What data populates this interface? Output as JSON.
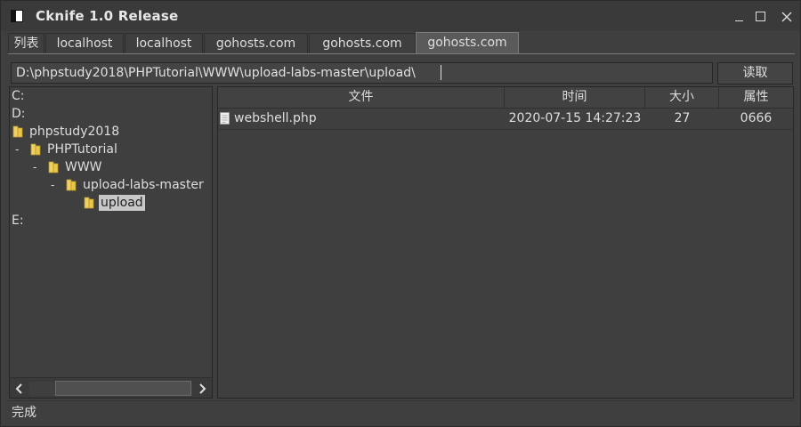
{
  "window": {
    "title": "Cknife 1.0 Release"
  },
  "tabs": [
    {
      "label": "列表"
    },
    {
      "label": "localhost"
    },
    {
      "label": "localhost"
    },
    {
      "label": "gohosts.com"
    },
    {
      "label": "gohosts.com"
    },
    {
      "label": "gohosts.com",
      "active": true
    }
  ],
  "toolbar": {
    "path_value": "D:\\phpstudy2018\\PHPTutorial\\WWW\\upload-labs-master\\upload\\",
    "read_label": "读取"
  },
  "tree": {
    "items": [
      {
        "label": "C:"
      },
      {
        "label": "D:"
      },
      {
        "label": "phpstudy2018"
      },
      {
        "label": "PHPTutorial"
      },
      {
        "label": "WWW"
      },
      {
        "label": "upload-labs-master"
      },
      {
        "label": "upload",
        "selected": true
      },
      {
        "label": "E:"
      }
    ],
    "collapse_marker": "-"
  },
  "files": {
    "columns": [
      {
        "label": "文件"
      },
      {
        "label": "时间"
      },
      {
        "label": "大小"
      },
      {
        "label": "属性"
      }
    ],
    "rows": [
      {
        "name": "webshell.php",
        "time": "2020-07-15 14:27:23",
        "size": "27",
        "attr": "0666"
      }
    ]
  },
  "status": {
    "text": "完成"
  },
  "colors": {
    "background": "#3f3f3f",
    "folder": "#e8c84a",
    "selection": "#c8c8c8"
  },
  "icons": {
    "folder": "folder-icon",
    "file": "file-icon",
    "minimize": "minimize-icon",
    "maximize": "maximize-icon",
    "close": "close-icon"
  }
}
